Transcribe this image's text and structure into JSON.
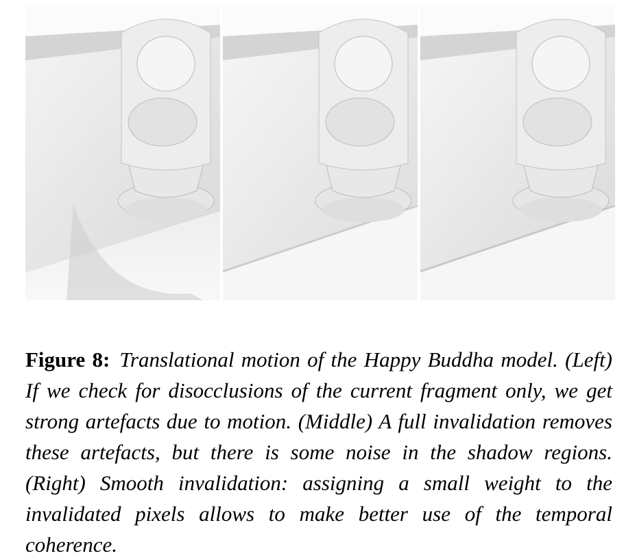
{
  "figure": {
    "label": "Figure 8:",
    "caption": "Translational motion of the Happy Buddha model. (Left) If we check for disocclusions of the current fragment only, we get strong artefacts due to motion. (Middle) A full invalidation removes these artefacts, but there is some noise in the shadow regions. (Right) Smooth invalidation: assigning a small weight to the invalidated pixels allows to make better use of the temporal coherence."
  }
}
